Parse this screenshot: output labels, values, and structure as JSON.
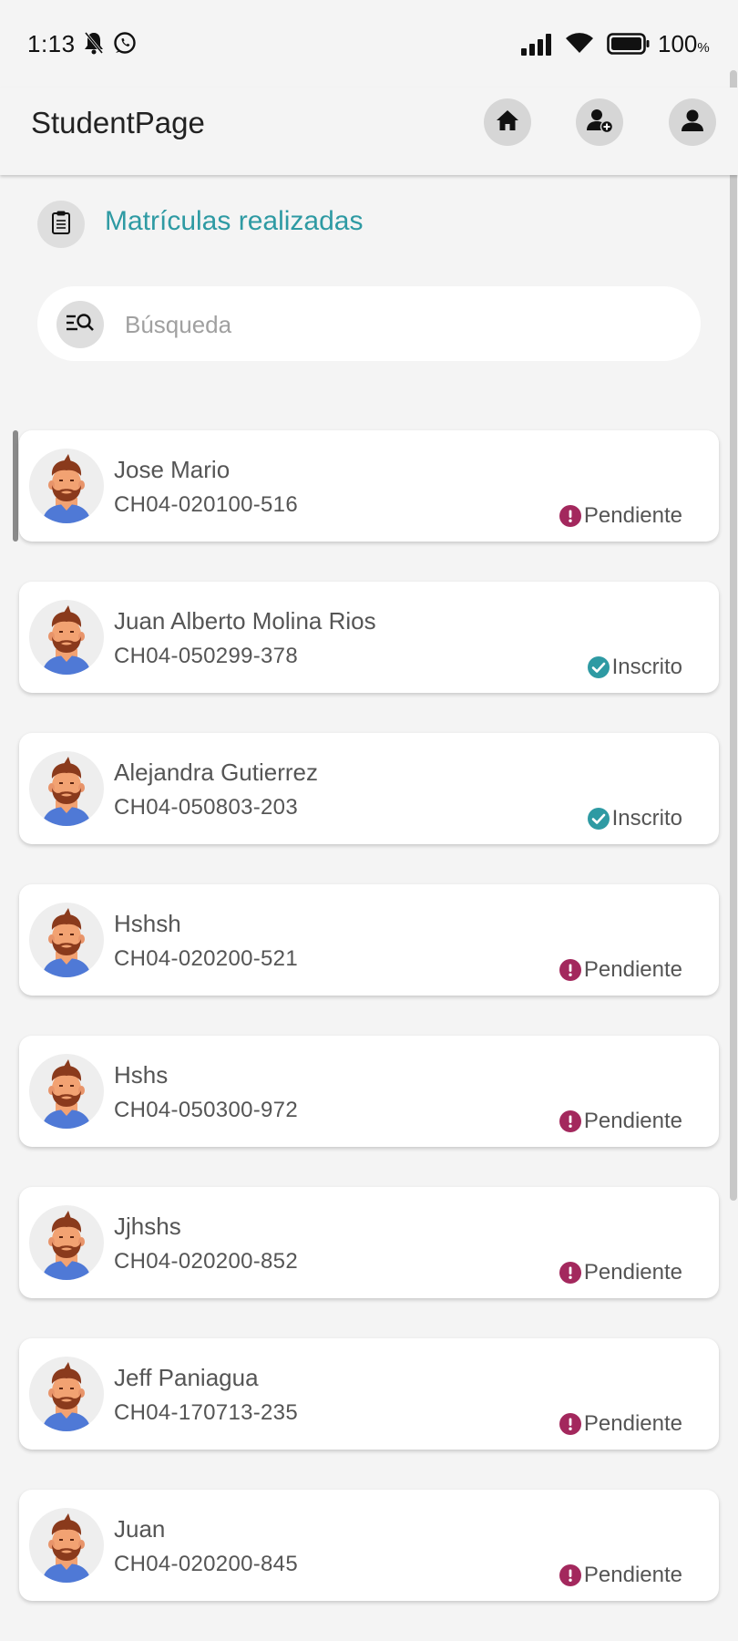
{
  "status_bar": {
    "time": "1:13",
    "battery_pct": "100",
    "battery_unit": "%"
  },
  "app": {
    "title": "StudentPage"
  },
  "section": {
    "title": "Matrículas realizadas"
  },
  "search": {
    "placeholder": "Búsqueda",
    "value": ""
  },
  "colors": {
    "accent": "#2e9aa3",
    "pending": "#a3285d",
    "enrolled": "#2e9aa3"
  },
  "students": [
    {
      "name": "Jose Mario",
      "code": "CH04-020100-516",
      "status": "Pendiente",
      "status_type": "pending"
    },
    {
      "name": "Juan Alberto Molina Rios",
      "code": "CH04-050299-378",
      "status": "Inscrito",
      "status_type": "enrolled"
    },
    {
      "name": "Alejandra Gutierrez",
      "code": "CH04-050803-203",
      "status": "Inscrito",
      "status_type": "enrolled"
    },
    {
      "name": "Hshsh",
      "code": "CH04-020200-521",
      "status": "Pendiente",
      "status_type": "pending"
    },
    {
      "name": "Hshs",
      "code": "CH04-050300-972",
      "status": "Pendiente",
      "status_type": "pending"
    },
    {
      "name": "Jjhshs",
      "code": "CH04-020200-852",
      "status": "Pendiente",
      "status_type": "pending"
    },
    {
      "name": "Jeff Paniagua",
      "code": "CH04-170713-235",
      "status": "Pendiente",
      "status_type": "pending"
    },
    {
      "name": "Juan",
      "code": "CH04-020200-845",
      "status": "Pendiente",
      "status_type": "pending"
    }
  ]
}
